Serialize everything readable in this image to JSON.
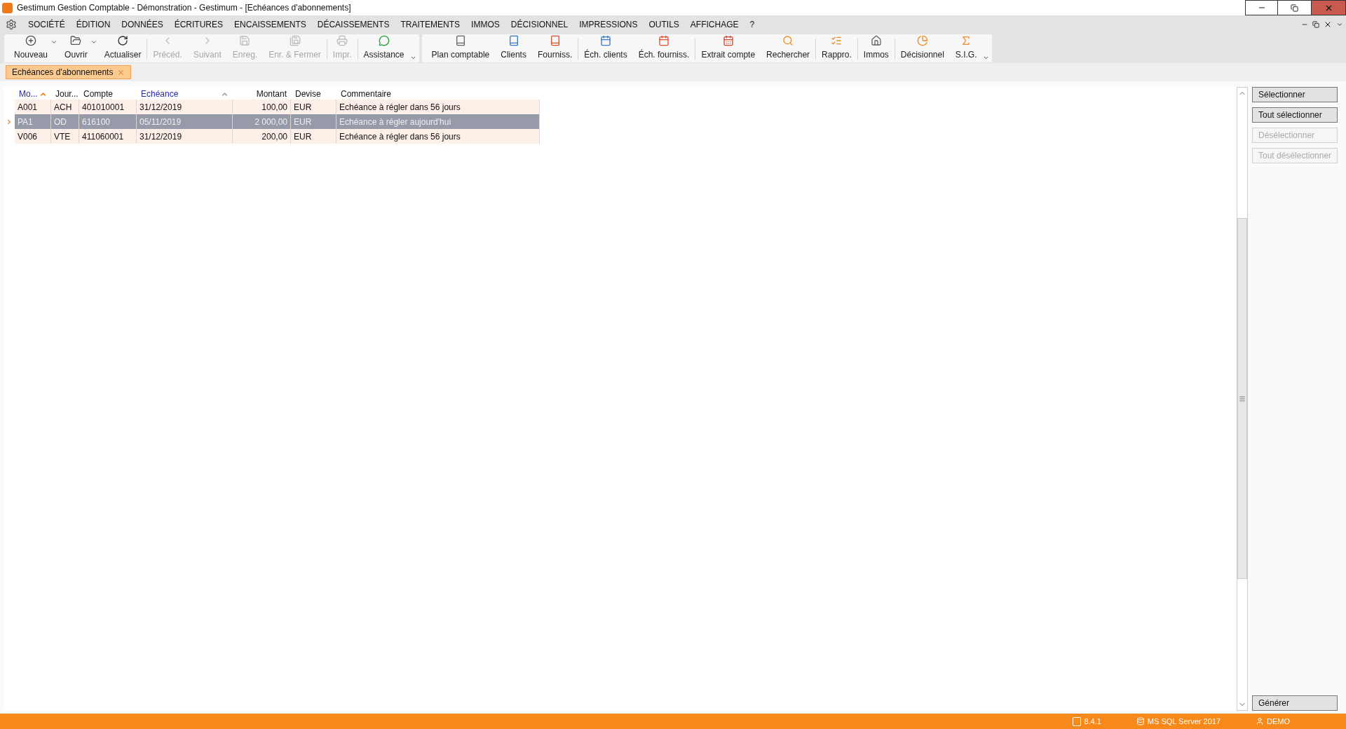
{
  "window": {
    "title": "Gestimum Gestion Comptable - Démonstration - Gestimum - [Echéances d'abonnements]"
  },
  "menu": [
    "SOCIÉTÉ",
    "ÉDITION",
    "DONNÉES",
    "ÉCRITURES",
    "ENCAISSEMENTS",
    "DÉCAISSEMENTS",
    "TRAITEMENTS",
    "IMMOS",
    "DÉCISIONNEL",
    "IMPRESSIONS",
    "OUTILS",
    "AFFICHAGE",
    "?"
  ],
  "toolbar": [
    {
      "label": "Nouveau",
      "disabled": false,
      "dropdown": true
    },
    {
      "label": "Ouvrir",
      "disabled": false,
      "dropdown": true
    },
    {
      "label": "Actualiser",
      "disabled": false,
      "dropdown": false
    },
    {
      "label": "Précéd.",
      "disabled": true,
      "dropdown": false
    },
    {
      "label": "Suivant",
      "disabled": true,
      "dropdown": false
    },
    {
      "label": "Enreg.",
      "disabled": true,
      "dropdown": false
    },
    {
      "label": "Enr. & Fermer",
      "disabled": true,
      "dropdown": false
    },
    {
      "label": "Impr.",
      "disabled": true,
      "dropdown": false
    },
    {
      "label": "Assistance",
      "disabled": false,
      "dropdown": false
    }
  ],
  "toolbar2": [
    {
      "label": "Plan comptable",
      "disabled": false
    },
    {
      "label": "Clients",
      "disabled": false
    },
    {
      "label": "Fourniss.",
      "disabled": false
    },
    {
      "label": "Éch. clients",
      "disabled": false
    },
    {
      "label": "Éch. fourniss.",
      "disabled": false
    },
    {
      "label": "Extrait compte",
      "disabled": false
    },
    {
      "label": "Rechercher",
      "disabled": false
    },
    {
      "label": "Rappro.",
      "disabled": false
    },
    {
      "label": "Immos",
      "disabled": false
    },
    {
      "label": "Décisionnel",
      "disabled": false
    },
    {
      "label": "S.I.G.",
      "disabled": false
    }
  ],
  "doc_tab": {
    "label": "Echéances d'abonnements",
    "selected": true
  },
  "table": {
    "columns": [
      {
        "label": "Mo...",
        "sorted": true,
        "grouped": false
      },
      {
        "label": "Jour...",
        "sorted": false,
        "grouped": false
      },
      {
        "label": "Compte",
        "sorted": false,
        "grouped": false
      },
      {
        "label": "Echéance",
        "sorted": false,
        "grouped": true
      },
      {
        "label": "Montant",
        "sorted": false,
        "grouped": false
      },
      {
        "label": "Devise",
        "sorted": false,
        "grouped": false
      },
      {
        "label": "Commentaire",
        "sorted": false,
        "grouped": false
      }
    ],
    "rows": [
      {
        "selected": false,
        "cells": [
          "A001",
          "ACH",
          "401010001",
          "31/12/2019",
          "100,00",
          "EUR",
          "Echéance à régler dans 56 jours"
        ]
      },
      {
        "selected": true,
        "cells": [
          "PA1",
          "OD",
          "616100",
          "05/11/2019",
          "2 000,00",
          "EUR",
          "Echéance à régler aujourd'hui"
        ]
      },
      {
        "selected": false,
        "cells": [
          "V006",
          "VTE",
          "411060001",
          "31/12/2019",
          "200,00",
          "EUR",
          "Echéance à régler dans 56 jours"
        ]
      }
    ]
  },
  "side_buttons": [
    {
      "label": "Sélectionner",
      "disabled": false
    },
    {
      "label": "Tout sélectionner",
      "disabled": false
    },
    {
      "label": "Désélectionner",
      "disabled": true
    },
    {
      "label": "Tout désélectionner",
      "disabled": true
    }
  ],
  "generate_button": {
    "label": "Générer",
    "disabled": false
  },
  "status_bar": {
    "version": "8.4.1",
    "database": "MS SQL Server 2017",
    "user": "DEMO"
  }
}
